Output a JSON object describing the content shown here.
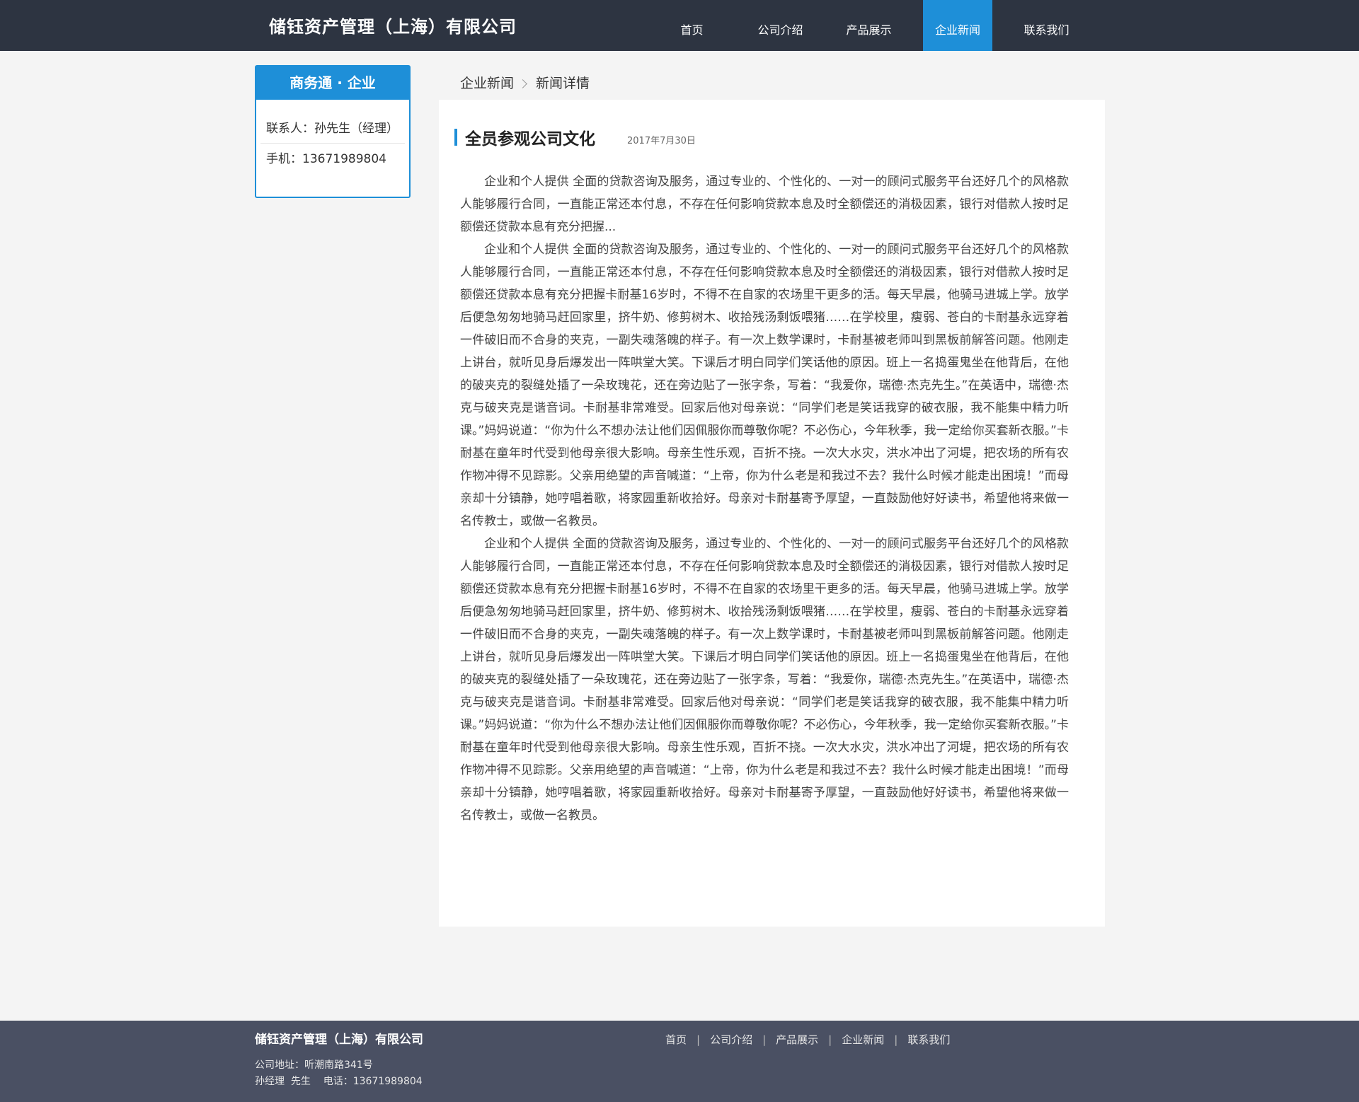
{
  "header": {
    "logo": "储钰资产管理（上海）有限公司",
    "nav": [
      "首页",
      "公司介绍",
      "产品展示",
      "企业新闻",
      "联系我们"
    ],
    "active_nav": "企业新闻"
  },
  "sidebar": {
    "title": "商务通 · 企业",
    "contact_person": "联系人：孙先生（经理）",
    "phone": "手机：13671989804"
  },
  "breadcrumb": {
    "section": "企业新闻",
    "current": "新闻详情"
  },
  "article": {
    "title": "全员参观公司文化",
    "date": "2017年7月30日",
    "paragraphs": [
      "企业和个人提供 全面的贷款咨询及服务，通过专业的、个性化的、一对一的顾问式服务平台还好几个的风格款人能够履行合同，一直能正常还本付息，不存在任何影响贷款本息及时全额偿还的消极因素，银行对借款人按时足额偿还贷款本息有充分把握...",
      "企业和个人提供 全面的贷款咨询及服务，通过专业的、个性化的、一对一的顾问式服务平台还好几个的风格款人能够履行合同，一直能正常还本付息，不存在任何影响贷款本息及时全额偿还的消极因素，银行对借款人按时足额偿还贷款本息有充分把握卡耐基16岁时，不得不在自家的农场里干更多的活。每天早晨，他骑马进城上学。放学后便急匆匆地骑马赶回家里，挤牛奶、修剪树木、收拾残汤剩饭喂猪……在学校里，瘦弱、苍白的卡耐基永远穿着一件破旧而不合身的夹克，一副失魂落魄的样子。有一次上数学课时，卡耐基被老师叫到黑板前解答问题。他刚走上讲台，就听见身后爆发出一阵哄堂大笑。下课后才明白同学们笑话他的原因。班上一名捣蛋鬼坐在他背后，在他的破夹克的裂缝处插了一朵玫瑰花，还在旁边贴了一张字条，写着：“我爱你，瑞德·杰克先生。”在英语中，瑞德·杰克与破夹克是谐音词。卡耐基非常难受。回家后他对母亲说：“同学们老是笑话我穿的破衣服，我不能集中精力听课。”妈妈说道：“你为什么不想办法让他们因佩服你而尊敬你呢？不必伤心，今年秋季，我一定给你买套新衣服。”卡耐基在童年时代受到他母亲很大影响。母亲生性乐观，百折不挠。一次大水灾，洪水冲出了河堤，把农场的所有农作物冲得不见踪影。父亲用绝望的声音喊道：“上帝，你为什么老是和我过不去？我什么时候才能走出困境！”而母亲却十分镇静，她哼唱着歌，将家园重新收拾好。母亲对卡耐基寄予厚望，一直鼓励他好好读书，希望他将来做一名传教士，或做一名教员。",
      "企业和个人提供 全面的贷款咨询及服务，通过专业的、个性化的、一对一的顾问式服务平台还好几个的风格款人能够履行合同，一直能正常还本付息，不存在任何影响贷款本息及时全额偿还的消极因素，银行对借款人按时足额偿还贷款本息有充分把握卡耐基16岁时，不得不在自家的农场里干更多的活。每天早晨，他骑马进城上学。放学后便急匆匆地骑马赶回家里，挤牛奶、修剪树木、收拾残汤剩饭喂猪……在学校里，瘦弱、苍白的卡耐基永远穿着一件破旧而不合身的夹克，一副失魂落魄的样子。有一次上数学课时，卡耐基被老师叫到黑板前解答问题。他刚走上讲台，就听见身后爆发出一阵哄堂大笑。下课后才明白同学们笑话他的原因。班上一名捣蛋鬼坐在他背后，在他的破夹克的裂缝处插了一朵玫瑰花，还在旁边贴了一张字条，写着：“我爱你，瑞德·杰克先生。”在英语中，瑞德·杰克与破夹克是谐音词。卡耐基非常难受。回家后他对母亲说：“同学们老是笑话我穿的破衣服，我不能集中精力听课。”妈妈说道：“你为什么不想办法让他们因佩服你而尊敬你呢？不必伤心，今年秋季，我一定给你买套新衣服。”卡耐基在童年时代受到他母亲很大影响。母亲生性乐观，百折不挠。一次大水灾，洪水冲出了河堤，把农场的所有农作物冲得不见踪影。父亲用绝望的声音喊道：“上帝，你为什么老是和我过不去？我什么时候才能走出困境！”而母亲却十分镇静，她哼唱着歌，将家园重新收拾好。母亲对卡耐基寄予厚望，一直鼓励他好好读书，希望他将来做一名传教士，或做一名教员。"
    ]
  },
  "footer": {
    "company": "储钰资产管理（上海）有限公司",
    "address": "公司地址：听潮南路341号",
    "contact": "孙经理  先生    电话：13671989804",
    "nav": [
      "首页",
      "公司介绍",
      "产品展示",
      "企业新闻",
      "联系我们"
    ],
    "separator": "|"
  },
  "colors": {
    "header_bg": "#2d3441",
    "accent": "#1e8fd8",
    "footer_bg": "#4a5063",
    "page_bg": "#f4f4f4"
  }
}
